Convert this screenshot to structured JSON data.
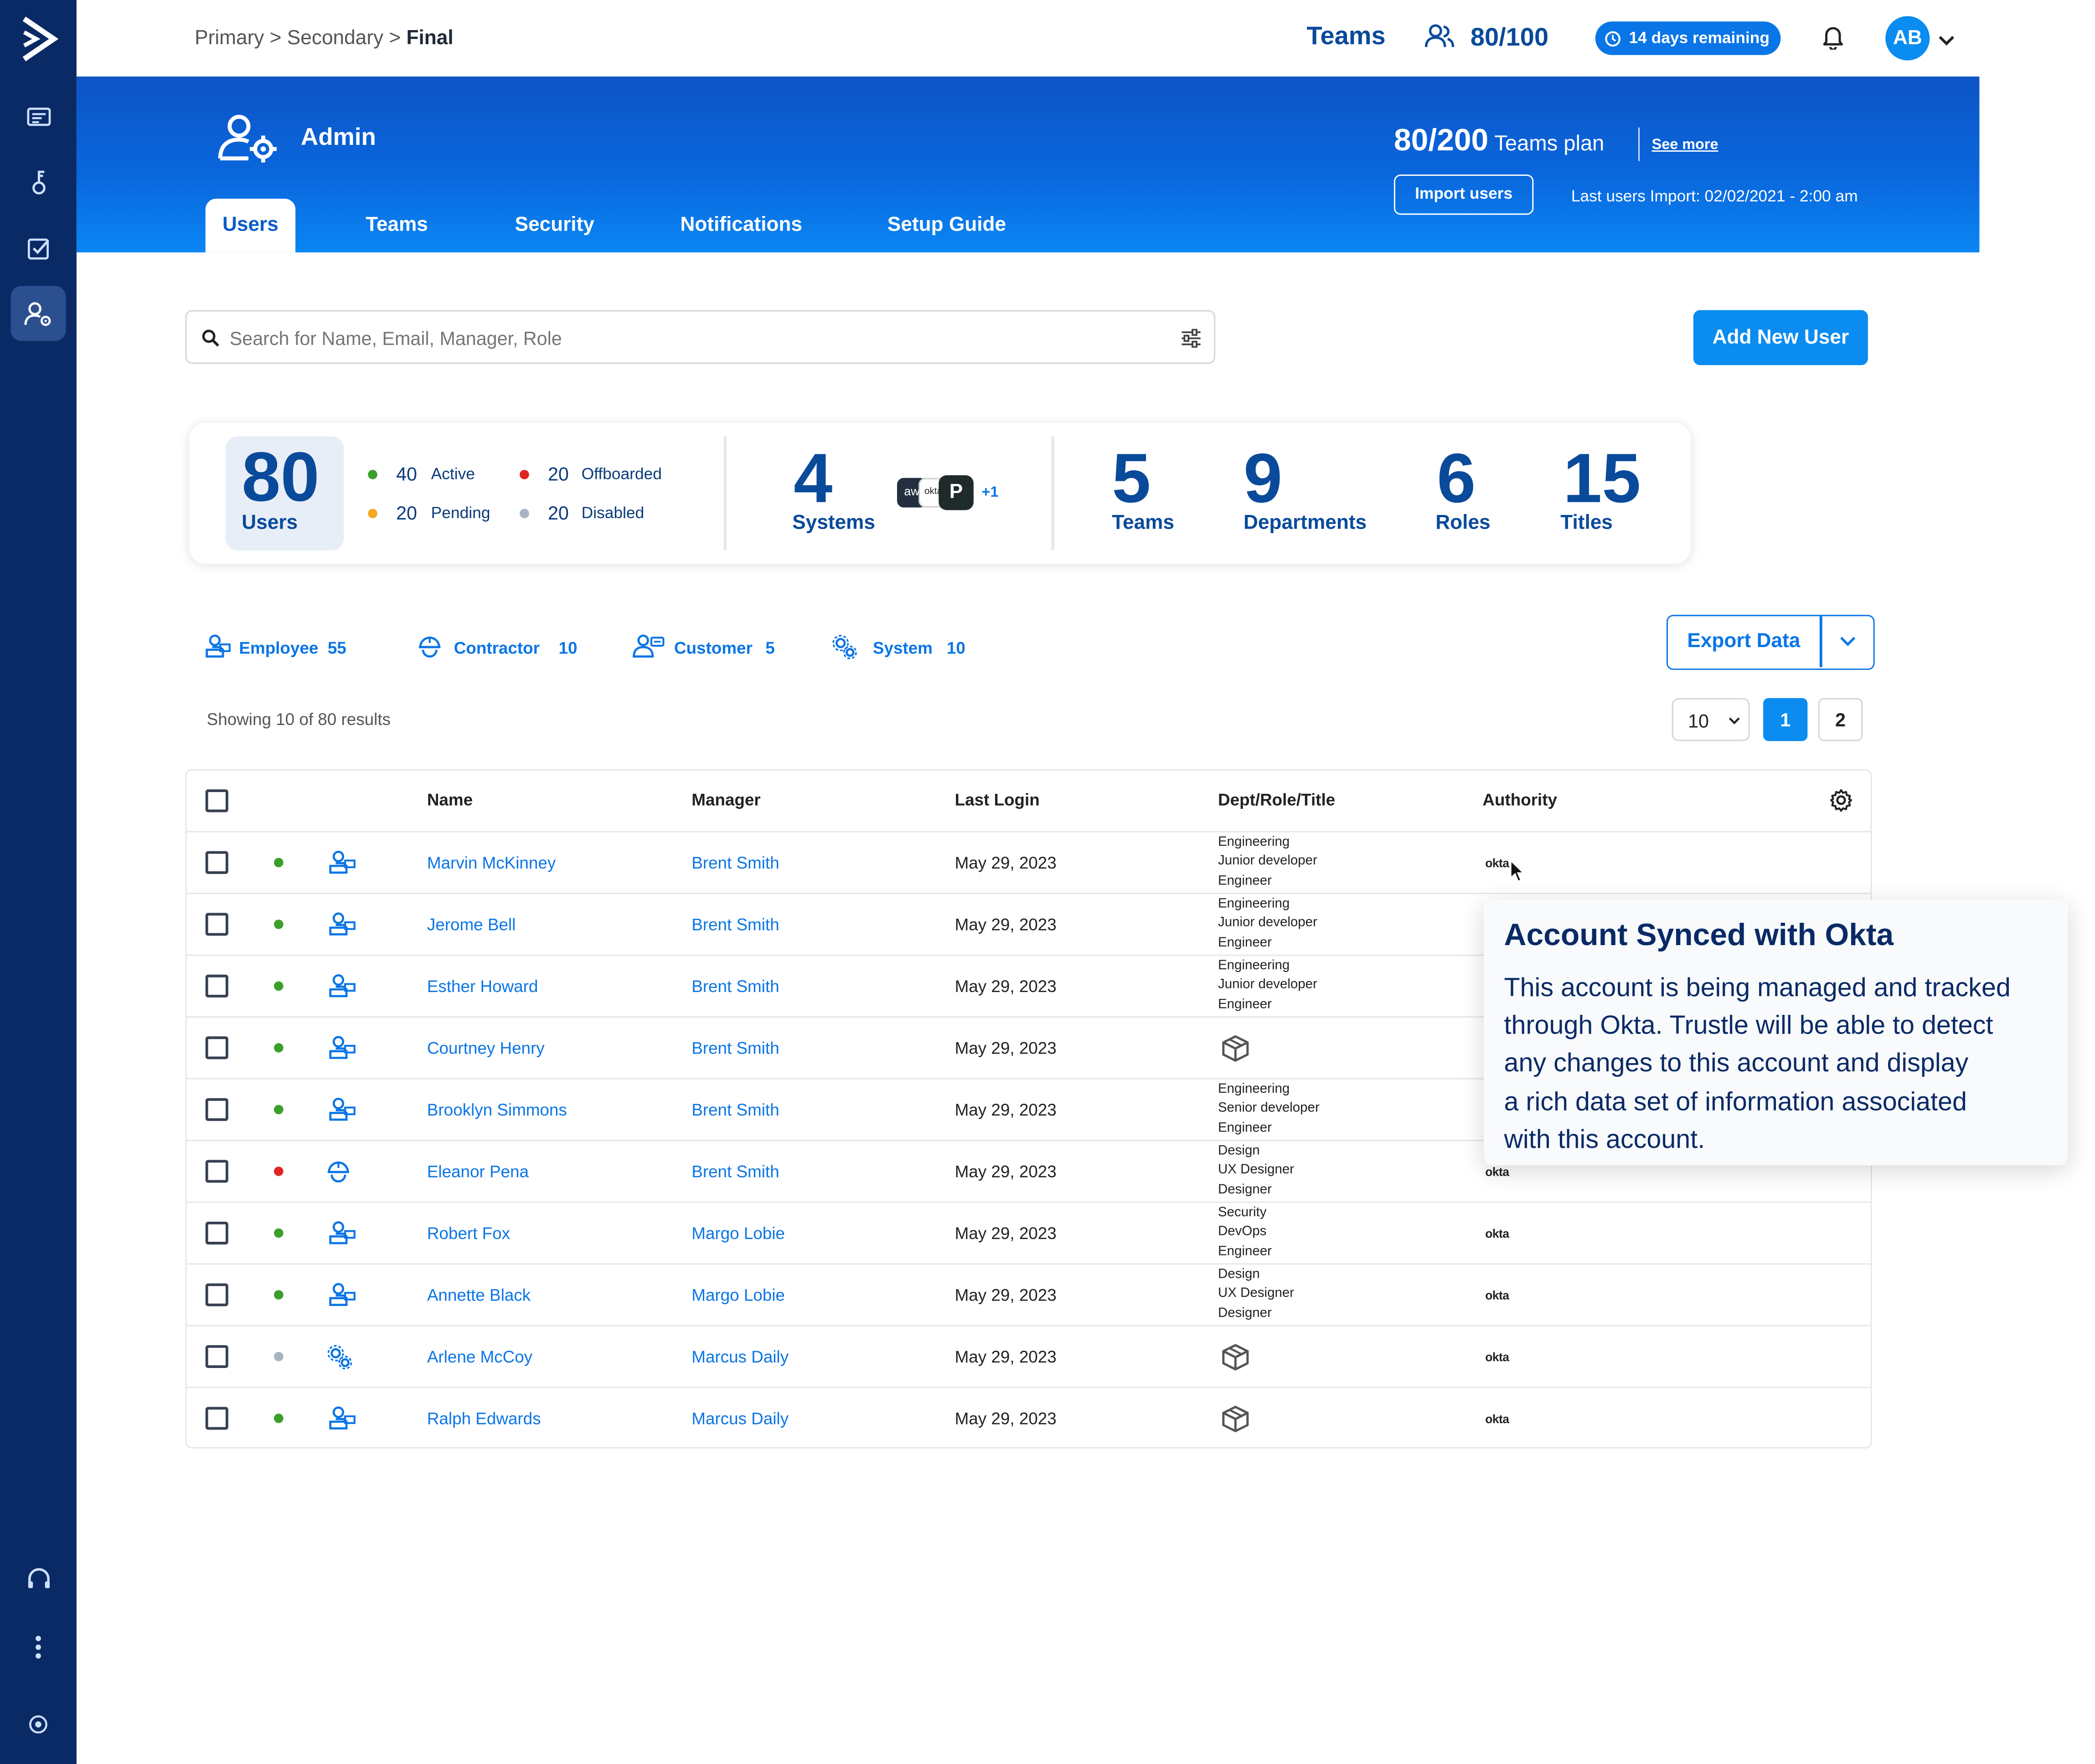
{
  "breadcrumb": {
    "primary": "Primary",
    "sep1": ">",
    "secondary": "Secondary",
    "sep2": ">",
    "final": "Final"
  },
  "topbar": {
    "teams_label": "Teams",
    "seat_usage": "80/100",
    "trial_badge": "14 days remaining",
    "avatar_initials": "AB"
  },
  "banner": {
    "title": "Admin",
    "plan_count": "80/200",
    "plan_name": "Teams plan",
    "see_more": "See more",
    "import_button": "Import users",
    "last_import": "Last users Import: 02/02/2021 - 2:00 am",
    "tabs": [
      {
        "label": "Users"
      },
      {
        "label": "Teams"
      },
      {
        "label": "Security"
      },
      {
        "label": "Notifications"
      },
      {
        "label": "Setup Guide"
      }
    ]
  },
  "search": {
    "placeholder": "Search for Name, Email, Manager, Role"
  },
  "add_user_button": "Add New User",
  "stats": {
    "users_count": "80",
    "users_label": "Users",
    "statuses": [
      {
        "count": "40",
        "label": "Active",
        "color": "#3aa02a"
      },
      {
        "count": "20",
        "label": "Offboarded",
        "color": "#e02424"
      },
      {
        "count": "20",
        "label": "Pending",
        "color": "#f5a623"
      },
      {
        "count": "20",
        "label": "Disabled",
        "color": "#a9b4c2"
      }
    ],
    "systems_count": "4",
    "systems_label": "Systems",
    "system_logos": [
      {
        "text": "aw"
      },
      {
        "text": "okta"
      },
      {
        "text": "P"
      }
    ],
    "systems_more": "+1",
    "teams_count": "5",
    "teams_label": "Teams",
    "departments_count": "9",
    "departments_label": "Departments",
    "roles_count": "6",
    "roles_label": "Roles",
    "titles_count": "15",
    "titles_label": "Titles"
  },
  "user_types": [
    {
      "label": "Employee",
      "count": "55",
      "icon": "employee-icon"
    },
    {
      "label": "Contractor",
      "count": "10",
      "icon": "contractor-icon"
    },
    {
      "label": "Customer",
      "count": "5",
      "icon": "customer-icon"
    },
    {
      "label": "System",
      "count": "10",
      "icon": "system-icon"
    }
  ],
  "export_button": "Export Data",
  "results_text": "Showing 10 of 80 results",
  "page_size": "10",
  "pages": [
    "1",
    "2"
  ],
  "table": {
    "columns": {
      "name": "Name",
      "manager": "Manager",
      "last_login": "Last Login",
      "dept": "Dept/Role/Title",
      "authority": "Authority"
    },
    "rows": [
      {
        "name": "Marvin McKinney",
        "manager": "Brent Smith",
        "last_login": "May 29, 2023",
        "dept": [
          "Engineering",
          "Junior developer",
          "Engineer"
        ],
        "authority": "okta",
        "status": "#3aa02a",
        "type": "employee"
      },
      {
        "name": "Jerome Bell",
        "manager": "Brent Smith",
        "last_login": "May 29, 2023",
        "dept": [
          "Engineering",
          "Junior developer",
          "Engineer"
        ],
        "authority": "",
        "status": "#3aa02a",
        "type": "employee"
      },
      {
        "name": "Esther Howard",
        "manager": "Brent Smith",
        "last_login": "May 29, 2023",
        "dept": [
          "Engineering",
          "Junior developer",
          "Engineer"
        ],
        "authority": "",
        "status": "#3aa02a",
        "type": "employee"
      },
      {
        "name": "Courtney Henry",
        "manager": "Brent Smith",
        "last_login": "May 29, 2023",
        "dept": [],
        "authority": "",
        "status": "#3aa02a",
        "type": "employee"
      },
      {
        "name": "Brooklyn Simmons",
        "manager": "Brent Smith",
        "last_login": "May 29, 2023",
        "dept": [
          "Engineering",
          "Senior developer",
          "Engineer"
        ],
        "authority": "",
        "status": "#3aa02a",
        "type": "employee"
      },
      {
        "name": "Eleanor Pena",
        "manager": "Brent Smith",
        "last_login": "May 29, 2023",
        "dept": [
          "Design",
          "UX Designer",
          "Designer"
        ],
        "authority": "okta",
        "status": "#e02424",
        "type": "contractor"
      },
      {
        "name": "Robert Fox",
        "manager": "Margo Lobie",
        "last_login": "May 29, 2023",
        "dept": [
          "Security",
          "DevOps",
          "Engineer"
        ],
        "authority": "okta",
        "status": "#3aa02a",
        "type": "employee"
      },
      {
        "name": "Annette Black",
        "manager": "Margo Lobie",
        "last_login": "May 29, 2023",
        "dept": [
          "Design",
          "UX Designer",
          "Designer"
        ],
        "authority": "okta",
        "status": "#3aa02a",
        "type": "employee"
      },
      {
        "name": "Arlene McCoy",
        "manager": "Marcus Daily",
        "last_login": "May 29, 2023",
        "dept": [],
        "authority": "okta",
        "status": "#a9b4c2",
        "type": "system"
      },
      {
        "name": "Ralph Edwards",
        "manager": "Marcus Daily",
        "last_login": "May 29, 2023",
        "dept": [],
        "authority": "okta",
        "status": "#3aa02a",
        "type": "employee"
      }
    ]
  },
  "tooltip": {
    "title": "Account Synced with Okta",
    "lines": [
      "This account is being managed and tracked",
      "through Okta. Trustle will be able to detect",
      "any changes to this account and display",
      "a rich data set of information associated",
      "with this account."
    ]
  }
}
